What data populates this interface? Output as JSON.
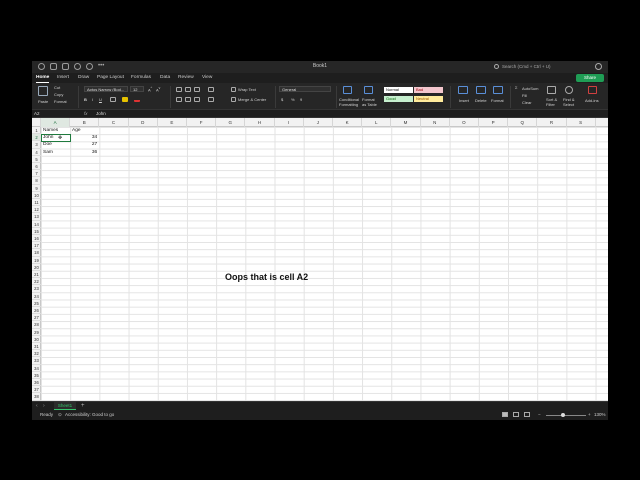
{
  "window": {
    "title": "Book1"
  },
  "search": {
    "text": "Search (Cmd + Ctrl + U)"
  },
  "tabs": [
    "Home",
    "Insert",
    "Draw",
    "Page Layout",
    "Formulas",
    "Data",
    "Review",
    "View"
  ],
  "share_label": "Share",
  "ribbon": {
    "paste": "Paste",
    "cut": "Cut",
    "copy": "Copy",
    "format": "Format",
    "font_name": "Aptos Narrow (Bod...",
    "font_size": "12",
    "bold": "B",
    "italic": "I",
    "underline": "U",
    "wrap_text": "Wrap Text",
    "merge_center": "Merge & Center",
    "number_format": "General",
    "currency": "$",
    "percent": "%",
    "comma": "9",
    "conditional_formatting": [
      "Conditional",
      "Formatting"
    ],
    "format_as_table": [
      "Format",
      "as Table"
    ],
    "styles": {
      "normal": "Normal",
      "bad": "Bad",
      "good": "Good",
      "neutral": "Neutral"
    },
    "insert": "Insert",
    "delete": "Delete",
    "format_cells": "Format",
    "autosum": "AutoSum",
    "fill": "Fill",
    "clear": "Clear",
    "sort_filter": [
      "Sort &",
      "Filter"
    ],
    "find_select": [
      "Find &",
      "Select"
    ],
    "addins": "Add-ins"
  },
  "formula_bar": {
    "name_box": "A2",
    "fx": "fx",
    "value": "John"
  },
  "columns": [
    "A",
    "B",
    "C",
    "D",
    "E",
    "F",
    "G",
    "H",
    "I",
    "J",
    "K",
    "L",
    "M",
    "N",
    "O",
    "P",
    "Q",
    "R",
    "S"
  ],
  "rows": [
    "1",
    "2",
    "3",
    "4",
    "5",
    "6",
    "7",
    "8",
    "9",
    "10",
    "11",
    "12",
    "13",
    "14",
    "15",
    "16",
    "17",
    "18",
    "19",
    "20",
    "21",
    "22",
    "23",
    "24",
    "25",
    "26",
    "27",
    "28",
    "29",
    "30",
    "31",
    "32",
    "33",
    "34",
    "35",
    "36",
    "37",
    "38"
  ],
  "cells": {
    "A1": "Names",
    "B1": "Age",
    "A2": "John",
    "B2": "34",
    "A3": "Doe",
    "B3": "27",
    "A4": "Sam",
    "B4": "36"
  },
  "overlay_text": "Oops that is cell A2",
  "sheet_tab": "Sheet1",
  "add_sheet": "+",
  "status": {
    "ready": "Ready",
    "accessibility": "Accessibility: Good to go",
    "zoom": "130%"
  },
  "colors": {
    "accent": "#1f7a3e",
    "share": "#1f9d55",
    "bad_bg": "#f4c7ce",
    "good_bg": "#c6efce",
    "neutral_bg": "#ffeb9c"
  }
}
